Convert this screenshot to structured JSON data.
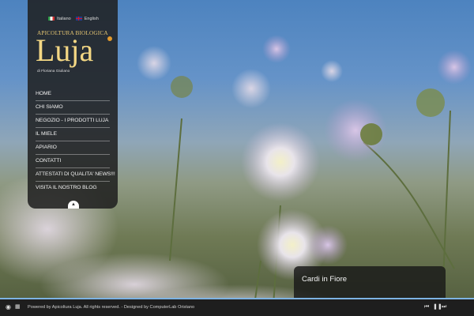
{
  "languages": [
    "Italiano",
    "English"
  ],
  "brand": {
    "top": "APICOLTURA BIOLOGICA",
    "logo": "Luja",
    "subtitle": "di Floriana Giuliano"
  },
  "menu": [
    "HOME",
    "CHI SIAMO",
    "NEGOZIO - I PRODOTTI LUJA",
    "IL MIELE",
    "APIARIO",
    "CONTATTI",
    "ATTESTATI DI QUALITA' NEWS!!!",
    "VISITA IL NOSTRO BLOG"
  ],
  "caption": "Cardi in Fiore",
  "footer": {
    "credits": "Powered by Apicoltura Luja. All rights reserved. - Designed by ComputerLab Oristano"
  },
  "colors": {
    "accent": "#f3d784",
    "progress": "#7db3e3"
  },
  "icons": [
    "eye-icon",
    "grid-icon",
    "prev-icon",
    "pause-icon",
    "next-icon",
    "chevron-up-icon"
  ]
}
